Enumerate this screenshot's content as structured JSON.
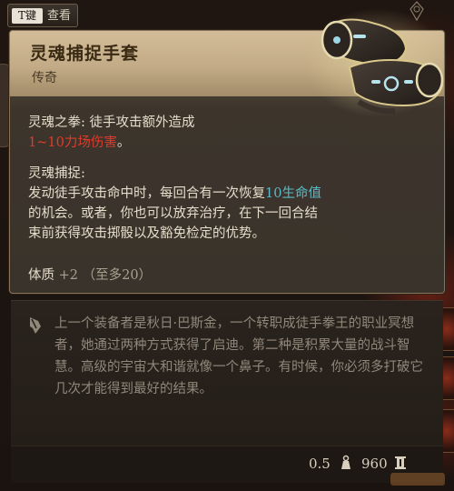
{
  "tab": {
    "key_label": "T键",
    "label": "查看"
  },
  "item": {
    "name": "灵魂捕捉手套",
    "rarity": "传奇",
    "effect1_title": "灵魂之拳: ",
    "effect1_desc": "徒手攻击额外造成",
    "effect1_damage": "1~10力场伤害",
    "effect1_end": "。",
    "effect2_title": "灵魂捕捉:",
    "effect2_line1_a": "发动徒手攻击命中时，每回合有一次恢复",
    "effect2_hp": "10生命值",
    "effect2_line2": "的机会。或者，你也可以放弃治疗，在下一回合结",
    "effect2_line3": "束前获得攻击掷骰以及豁免检定的优势。",
    "stat_name": "体质",
    "stat_value": "+2",
    "stat_limit": "（至多20）"
  },
  "lore": {
    "text": "上一个装备者是秋日·巴斯金，一个转职成徒手拳王的职业冥想者，她通过两种方式获得了启迪。第二种是积累大量的战斗智慧。高级的宇宙大和谐就像一个鼻子。有时候，你必须多打破它几次才能得到最好的结果。"
  },
  "footer": {
    "weight": "0.5",
    "price": "960"
  },
  "icons": {
    "gloves": "soul-catching-gloves-icon",
    "lore": "quill-icon",
    "weight": "weight-icon",
    "coin": "coin-icon"
  },
  "colors": {
    "damage": "#e03b2a",
    "heal": "#5ab9c8",
    "header": "#c8b18c"
  }
}
